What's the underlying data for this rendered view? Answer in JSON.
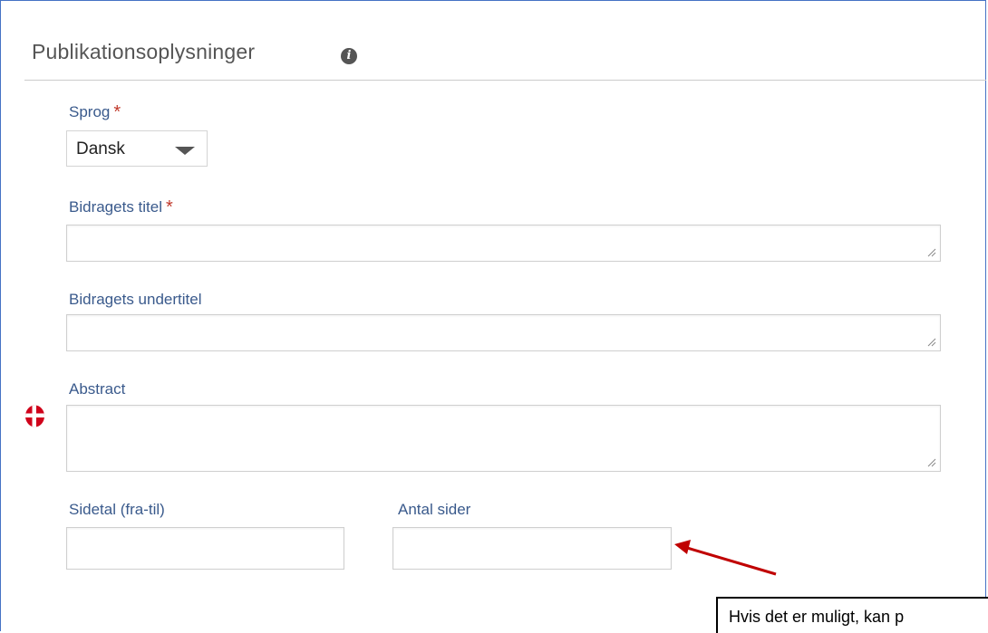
{
  "section": {
    "title": "Publikationsoplysninger",
    "info_icon": "info-icon"
  },
  "form": {
    "language": {
      "label": "Sprog",
      "required_mark": "*",
      "selected": "Dansk"
    },
    "contribution_title": {
      "label": "Bidragets titel",
      "required_mark": "*",
      "value": ""
    },
    "contribution_subtitle": {
      "label": "Bidragets undertitel",
      "value": ""
    },
    "abstract": {
      "label": "Abstract",
      "value": "",
      "language_flag_icon": "danish-flag-icon"
    },
    "pages": {
      "label": "Sidetal (fra-til)",
      "value": ""
    },
    "page_count": {
      "label": "Antal sider",
      "value": ""
    }
  },
  "annotation": {
    "callout_text": "Hvis det er muligt, kan p",
    "arrow_color": "#c00000"
  },
  "colors": {
    "label": "#3a5a8c",
    "required": "#c0392b",
    "frame": "#4472c4"
  }
}
